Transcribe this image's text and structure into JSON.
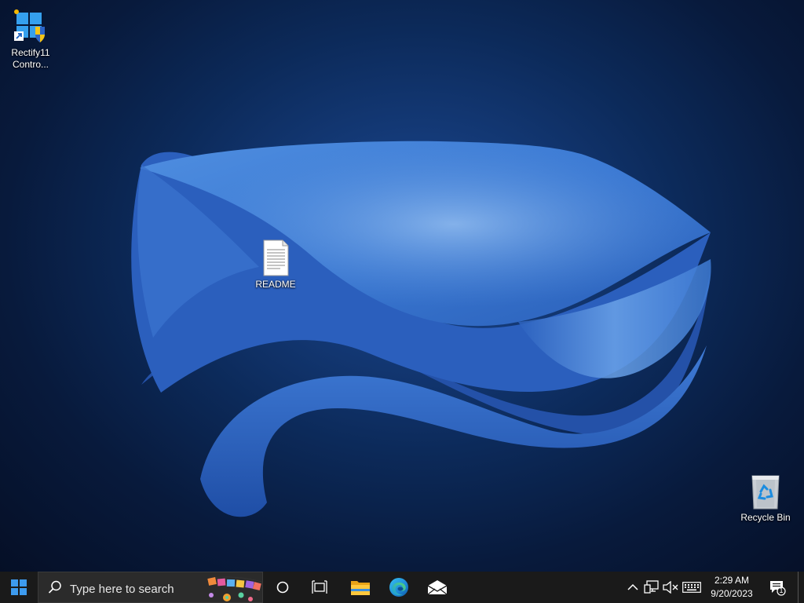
{
  "desktop": {
    "icons": [
      {
        "label_line1": "Rectify11",
        "label_line2": "Contro...",
        "icon": "rectify11-control-panel-shortcut-icon"
      },
      {
        "label": "README",
        "icon": "text-document-icon"
      },
      {
        "label": "Recycle Bin",
        "icon": "recycle-bin-icon"
      }
    ]
  },
  "taskbar": {
    "start_icon": "windows-logo-icon",
    "search": {
      "placeholder": "Type here to search",
      "icon": "search-icon"
    },
    "cortana_icon": "cortana-circle-icon",
    "task_view_icon": "task-view-icon",
    "pinned_apps": [
      {
        "name": "File Explorer",
        "icon": "file-explorer-icon"
      },
      {
        "name": "Microsoft Edge",
        "icon": "edge-icon"
      },
      {
        "name": "Mail",
        "icon": "mail-icon"
      }
    ],
    "tray": {
      "overflow_icon": "chevron-up-icon",
      "network_icon": "network-icon",
      "volume_icon": "volume-muted-icon",
      "keyboard_icon": "keyboard-icon",
      "time": "2:29 AM",
      "date": "9/20/2023",
      "notifications_count": "1",
      "notifications_icon": "action-center-icon"
    }
  },
  "colors": {
    "taskbar_bg": "#1a1a1a",
    "wallpaper_accent": "#3a7bd5",
    "wallpaper_dark": "#0a1834"
  }
}
